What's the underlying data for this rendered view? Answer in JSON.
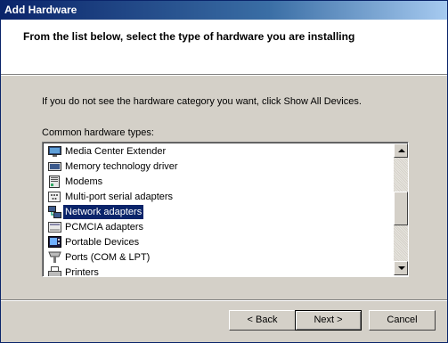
{
  "window": {
    "title": "Add Hardware"
  },
  "header": {
    "text": "From the list below, select the type of hardware you are installing"
  },
  "instruction": "If you do not see the hardware category you want, click Show All Devices.",
  "list": {
    "label": "Common hardware types:",
    "selected_index": 4,
    "items": [
      {
        "label": "Media Center Extender",
        "icon": "media-center-extender-icon"
      },
      {
        "label": "Memory technology driver",
        "icon": "memory-technology-driver-icon"
      },
      {
        "label": "Modems",
        "icon": "modem-icon"
      },
      {
        "label": "Multi-port serial adapters",
        "icon": "multiport-serial-adapter-icon"
      },
      {
        "label": "Network adapters",
        "icon": "network-adapter-icon"
      },
      {
        "label": "PCMCIA adapters",
        "icon": "pcmcia-adapter-icon"
      },
      {
        "label": "Portable Devices",
        "icon": "portable-device-icon"
      },
      {
        "label": "Ports (COM & LPT)",
        "icon": "port-icon"
      },
      {
        "label": "Printers",
        "icon": "printer-icon"
      }
    ]
  },
  "buttons": {
    "back": "< Back",
    "next": "Next >",
    "cancel": "Cancel"
  },
  "colors": {
    "selection": "#0a246a",
    "dialog_bg": "#d4d0c8",
    "title_start": "#0a246a",
    "title_end": "#a6caf0"
  }
}
